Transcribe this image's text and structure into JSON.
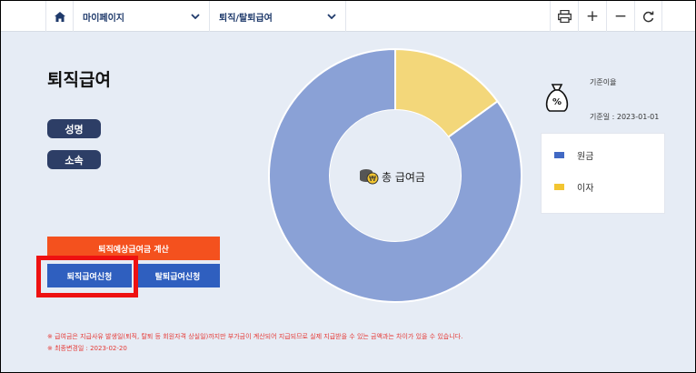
{
  "topbar": {
    "menu1": "마이페이지",
    "menu2": "퇴직/탈퇴급여",
    "icons": [
      "home-icon",
      "chevron-down-icon",
      "printer-icon",
      "plus-icon",
      "minus-icon",
      "refresh-icon"
    ]
  },
  "page": {
    "title": "퇴직급여",
    "name_label": "성명",
    "dept_label": "소속"
  },
  "buttons": {
    "calc": "퇴직예상급여금 계산",
    "apply_retirement": "퇴직급여신청",
    "apply_withdrawal": "탈퇴급여신청"
  },
  "chart_data": {
    "type": "pie",
    "center_label": "총 급여금",
    "series": [
      {
        "name": "원금",
        "value": 0.85,
        "color": "#8aa1d6"
      },
      {
        "name": "이자",
        "value": 0.15,
        "color": "#f3d77a"
      }
    ]
  },
  "info": {
    "base_rate_label": "기준이율",
    "base_date": "기준일 : 2023-01-01"
  },
  "legend": {
    "principal": "원금",
    "interest": "이자",
    "principal_color": "#4169c4",
    "interest_color": "#f2c531"
  },
  "notes": {
    "note1": "※ 급여금은 지급사유 발생일(퇴직, 탈퇴 등 회원자격 상실일)까지만 부가금이 계산되어 지급되므로 실제 지급받을 수 있는 금액과는 차이가 있을 수 있습니다.",
    "note2": "※ 최종변경일 : 2023-02-20"
  },
  "colors": {
    "accent": "#f4511e",
    "primary": "#2f5fbf",
    "highlight": "#ee1111"
  }
}
